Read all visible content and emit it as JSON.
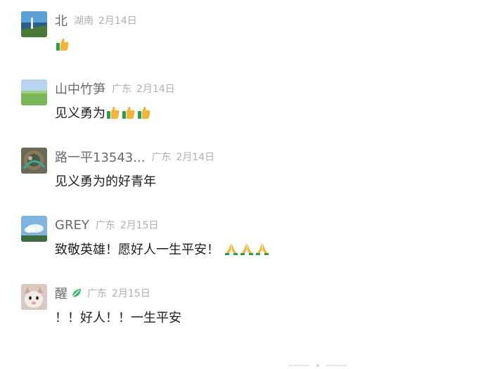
{
  "comments": [
    {
      "name": "北",
      "location": "湖南",
      "date": "2月14日",
      "text": "",
      "emoji": [
        "thumbs-up-icon"
      ]
    },
    {
      "name": "山中竹笋",
      "location": "广东",
      "date": "2月14日",
      "text": "见义勇为",
      "emoji": [
        "thumbs-up-icon",
        "thumbs-up-icon",
        "thumbs-up-icon"
      ]
    },
    {
      "name": "路一平13543...",
      "location": "广东",
      "date": "2月14日",
      "text": "见义勇为的好青年",
      "emoji": []
    },
    {
      "name": "GREY",
      "location": "广东",
      "date": "2月15日",
      "text": "致敬英雄！愿好人一生平安！",
      "emoji": [
        "praying-hands-icon",
        "praying-hands-icon",
        "praying-hands-icon"
      ]
    },
    {
      "name": "醒",
      "location": "广东",
      "date": "2月15日",
      "text": "！！好人！！一生平安",
      "emoji": [],
      "name_badge": "leaf-icon"
    }
  ],
  "colors": {
    "name": "#6a6a6a",
    "meta": "#b0b0b0",
    "text": "#1e1e1e",
    "leaf": "#3fb65f"
  }
}
